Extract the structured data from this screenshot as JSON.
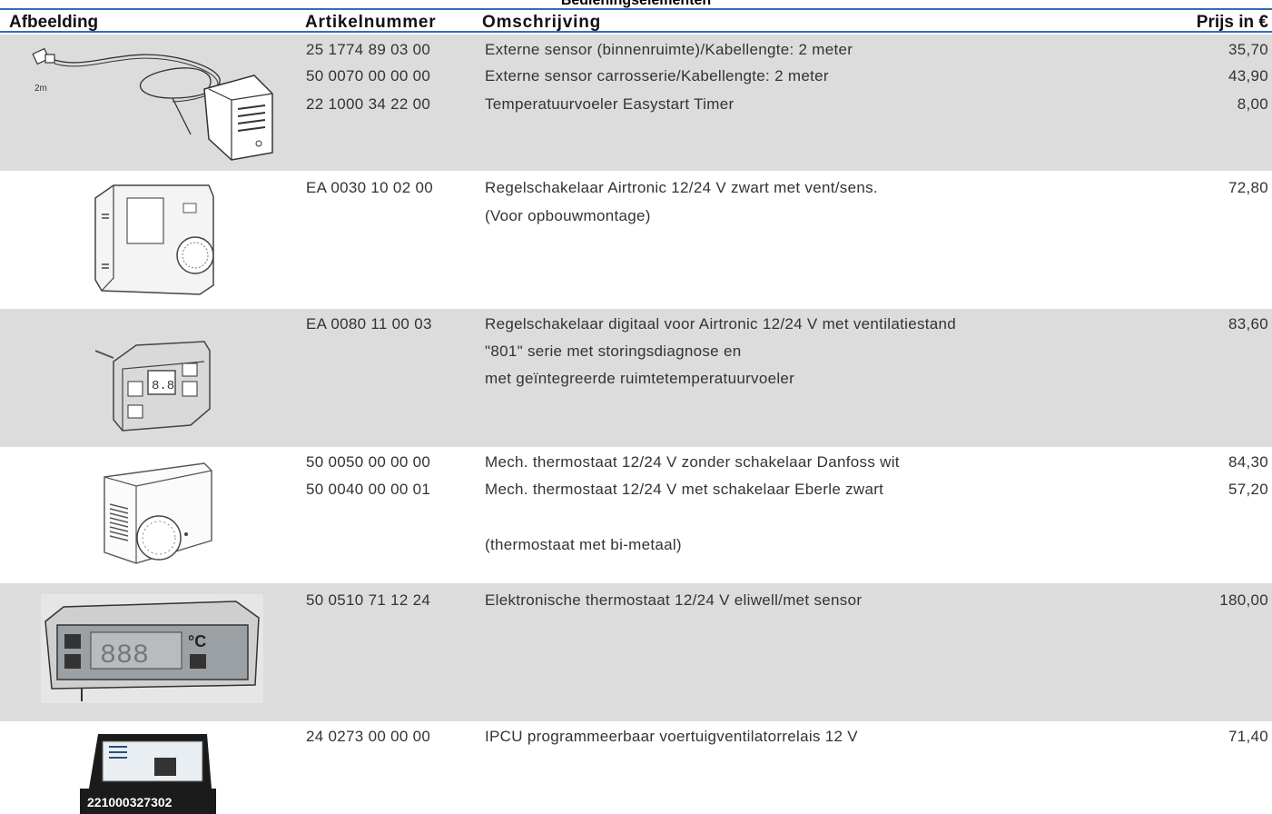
{
  "section_title": "Bedieningselementen",
  "header": {
    "afbeelding": "Afbeelding",
    "artikelnummer": "Artikelnummer",
    "omschrijving": "Omschrijving",
    "prijs": "Prijs in €"
  },
  "rows": [
    {
      "image_label": "2m",
      "image_icon": "external-sensor-image",
      "artikel": [
        "25 1774 89 03 00",
        "50 0070 00 00 00",
        "22 1000 34 22 00"
      ],
      "omschrijving": [
        "Externe sensor (binnenruimte)/Kabellengte: 2 meter",
        "Externe sensor carrosserie/Kabellengte: 2 meter",
        "Temperatuurvoeler Easystart Timer"
      ],
      "prijs": [
        "35,70",
        "43,90",
        "8,00"
      ]
    },
    {
      "image_icon": "control-switch-image",
      "artikel": [
        "EA 0030 10 02 00"
      ],
      "omschrijving": [
        "Regelschakelaar Airtronic 12/24 V zwart met vent/sens.",
        "(Voor opbouwmontage)"
      ],
      "prijs": [
        "72,80"
      ]
    },
    {
      "image_icon": "digital-control-switch-image",
      "artikel": [
        "EA 0080 11 00 03"
      ],
      "omschrijving": [
        "Regelschakelaar digitaal voor Airtronic 12/24 V met ventilatiestand",
        "\"801\" serie met storingsdiagnose en",
        "met geïntegreerde ruimtetemperatuurvoeler"
      ],
      "prijs": [
        "83,60"
      ]
    },
    {
      "image_icon": "mechanical-thermostat-image",
      "artikel": [
        "50 0050 00 00 00",
        "50 0040 00 00 01"
      ],
      "omschrijving": [
        "Mech. thermostaat 12/24 V zonder schakelaar Danfoss wit",
        "Mech. thermostaat 12/24 V met schakelaar Eberle zwart",
        "(thermostaat met bi-metaal)"
      ],
      "prijs": [
        "84,30",
        "57,20"
      ]
    },
    {
      "image_icon": "electronic-thermostat-image",
      "image_label": "888",
      "artikel": [
        "50 0510 71 12 24"
      ],
      "omschrijving": [
        "Elektronische thermostaat 12/24 V eliwell/met sensor"
      ],
      "prijs": [
        "180,00"
      ]
    },
    {
      "image_icon": "ipcu-relay-image",
      "image_label": "221000327302",
      "artikel": [
        "24 0273 00 00 00"
      ],
      "omschrijving": [
        "IPCU programmeerbaar voertuigventilatorrelais 12 V"
      ],
      "prijs": [
        "71,40"
      ]
    }
  ]
}
